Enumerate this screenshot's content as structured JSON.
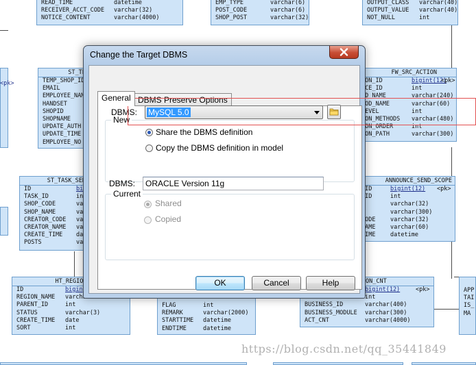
{
  "background": {
    "tables": [
      {
        "id": "t1",
        "title": "",
        "rows": [
          [
            "READ_TIME",
            "datetime",
            ""
          ],
          [
            "RECEIVER_ACCT_CODE",
            "varchar(32)",
            ""
          ],
          [
            "NOTICE_CONTENT",
            "varchar(4000)",
            ""
          ]
        ]
      },
      {
        "id": "t2",
        "title": "",
        "rows": [
          [
            "EMP_TYPE",
            "varchar(6)",
            ""
          ],
          [
            "POST_CODE",
            "varchar(6)",
            ""
          ],
          [
            "SHOP_POST",
            "varchar(32)",
            ""
          ]
        ]
      },
      {
        "id": "t3",
        "title": "",
        "rows": [
          [
            "OUTPUT_CLASS",
            "varchar(40)",
            ""
          ],
          [
            "OUTPUT_VALUE",
            "varchar(40)",
            ""
          ],
          [
            "NOT_NULL",
            "int",
            ""
          ]
        ]
      },
      {
        "id": "t4",
        "title": "ST_TEM",
        "rows": [
          [
            "TEMP_SHOP_ID",
            "",
            ""
          ],
          [
            "EMAIL",
            "",
            ""
          ],
          [
            "EMPLOYEE_NAM",
            "",
            ""
          ],
          [
            "HANDSET",
            "",
            ""
          ],
          [
            "SHOPID",
            "",
            ""
          ],
          [
            "SHOPNAME",
            "",
            ""
          ],
          [
            "UPDATE_AUTH",
            "",
            ""
          ],
          [
            "UPDATE_TIME",
            "",
            ""
          ],
          [
            "EMPLOYEE_NO",
            "",
            ""
          ]
        ]
      },
      {
        "id": "t5",
        "title": "FW_SRC_ACTION",
        "rows": [
          [
            "ION_ID",
            "bigint(12)",
            "<pk>"
          ],
          [
            "RCE_ID",
            "int",
            ""
          ],
          [
            "OD_NAME",
            "varchar(240)",
            ""
          ],
          [
            "HOD_NAME",
            "varchar(60)",
            ""
          ],
          [
            "LEVEL",
            "int",
            ""
          ],
          [
            "ION_METHODS",
            "varchar(480)",
            ""
          ],
          [
            "ION_ORDER",
            "int",
            ""
          ],
          [
            "ION_PATH",
            "varchar(300)",
            ""
          ]
        ]
      },
      {
        "id": "t6",
        "title": "ST_TASK_SEN",
        "rows": [
          [
            "ID",
            "bigi",
            ""
          ],
          [
            "TASK_ID",
            "int",
            ""
          ],
          [
            "SHOP_CODE",
            "va",
            ""
          ],
          [
            "SHOP_NAME",
            "va",
            ""
          ],
          [
            "CREATOR_CODE",
            "va",
            ""
          ],
          [
            "CREATOR_NAME",
            "va",
            ""
          ],
          [
            "CREATE_TIME",
            "date",
            ""
          ],
          [
            "POSTS",
            "va",
            ""
          ]
        ]
      },
      {
        "id": "t7",
        "title": "ANNOUNCE_SEND_SCOPE",
        "rows": [
          [
            "_ID",
            "bigint(12)",
            "<pk>"
          ],
          [
            "_ID",
            "int",
            ""
          ],
          [
            "E",
            "varchar(32)",
            ""
          ],
          [
            "E",
            "varchar(300)",
            ""
          ],
          [
            "CODE",
            "varchar(32)",
            ""
          ],
          [
            "NAME",
            "varchar(60)",
            ""
          ],
          [
            "TIME",
            "datetime",
            ""
          ]
        ]
      },
      {
        "id": "t8",
        "title": "HT_REGION",
        "rows": [
          [
            "ID",
            "bigin",
            ""
          ],
          [
            "REGION_NAME",
            "varcha",
            ""
          ],
          [
            "PARENT_ID",
            "int",
            ""
          ],
          [
            "STATUS",
            "varchar(3)",
            ""
          ],
          [
            "CREATE_TIME",
            "date",
            ""
          ],
          [
            "SORT",
            "int",
            ""
          ]
        ]
      },
      {
        "id": "t9",
        "title": "",
        "rows": [
          [
            "FLAG",
            "int",
            ""
          ],
          [
            "REMARK",
            "varchar(2000)",
            ""
          ],
          [
            "STARTTIME",
            "datetime",
            ""
          ],
          [
            "ENDTIME",
            "datetime",
            ""
          ]
        ]
      },
      {
        "id": "t10",
        "title": "ON_CNT",
        "rows": [
          [
            "",
            "bigint(12)",
            "<pk>"
          ],
          [
            "",
            "int",
            ""
          ],
          [
            "BUSINESS_ID",
            "varchar(400)",
            ""
          ],
          [
            "BUSINESS_MODULE",
            "varchar(300)",
            ""
          ],
          [
            "ACT_CNT",
            "varchar(4000)",
            ""
          ]
        ]
      },
      {
        "id": "t11",
        "title": "",
        "rows": [
          [
            "APP",
            "",
            ""
          ],
          [
            "TAI",
            "",
            ""
          ],
          [
            "IS_",
            "",
            ""
          ],
          [
            "MA",
            "",
            ""
          ]
        ]
      }
    ],
    "pk_right_label": "<pk>",
    "watermark": "https://blog.csdn.net/qq_35441849"
  },
  "dialog": {
    "title": "Change the Target DBMS",
    "tabs": [
      {
        "label": "General"
      },
      {
        "label": "DBMS Preserve Options"
      }
    ],
    "new_group": {
      "label": "New",
      "dbms_label": "DBMS:",
      "dbms_selected": "MySQL 5.0",
      "radio_share": "Share the DBMS definition",
      "radio_copy": "Copy the DBMS definition in model"
    },
    "current_group": {
      "label": "Current",
      "dbms_label": "DBMS:",
      "dbms_value": "ORACLE Version 11g",
      "radio_shared": "Shared",
      "radio_copied": "Copied"
    },
    "buttons": {
      "ok": "OK",
      "cancel": "Cancel",
      "help": "Help"
    }
  },
  "colors": {
    "table_fill": "#cfe4f8",
    "table_border": "#6e9fce",
    "highlight": "#3399ff",
    "annotation": "#e25050"
  }
}
